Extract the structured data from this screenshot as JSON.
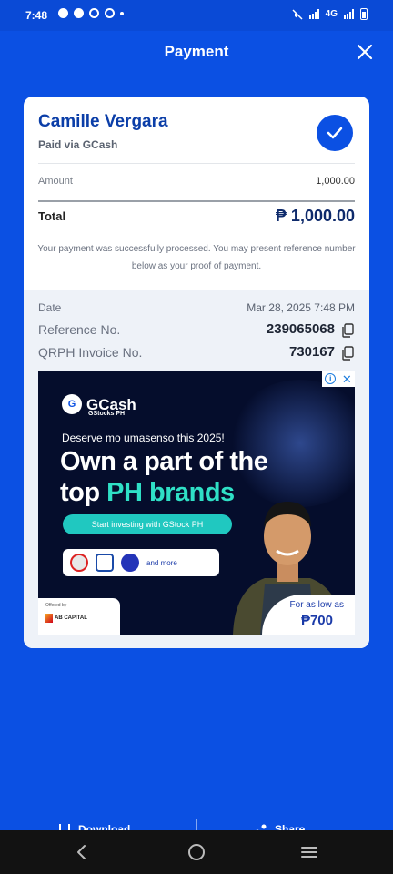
{
  "status_bar": {
    "time": "7:48",
    "network": "4G"
  },
  "header": {
    "title": "Payment"
  },
  "receipt": {
    "payee_name": "Camille Vergara",
    "paid_via": "Paid via GCash",
    "amount_label": "Amount",
    "amount_value": "1,000.00",
    "total_label": "Total",
    "total_value": "₱ 1,000.00",
    "message": "Your payment was successfully processed. You may present reference number below as your proof of payment.",
    "date_label": "Date",
    "date_value": "Mar 28, 2025 7:48 PM",
    "reference_label": "Reference No.",
    "reference_value": "239065068",
    "invoice_label": "QRPH Invoice No.",
    "invoice_value": "730167"
  },
  "ad": {
    "brand": "GCash",
    "sub_brand": "GStocks PH",
    "tagline": "Deserve mo umasenso this 2025!",
    "headline_line1": "Own a part of the",
    "headline_line2_prefix": "top ",
    "headline_line2_accent": "PH brands",
    "cta": "Start investing with GStock PH",
    "brands_more": "and more",
    "offered_by": "Offered by",
    "partner": "AB CAPITAL",
    "price_prefix": "For as low as",
    "price": "₱700",
    "info_icon": "i",
    "close_icon": "✕"
  },
  "actions": {
    "download": "Download",
    "share": "Share"
  },
  "colors": {
    "primary": "#0b50e3",
    "accent_teal": "#2fe0c6",
    "card": "#ffffff"
  }
}
